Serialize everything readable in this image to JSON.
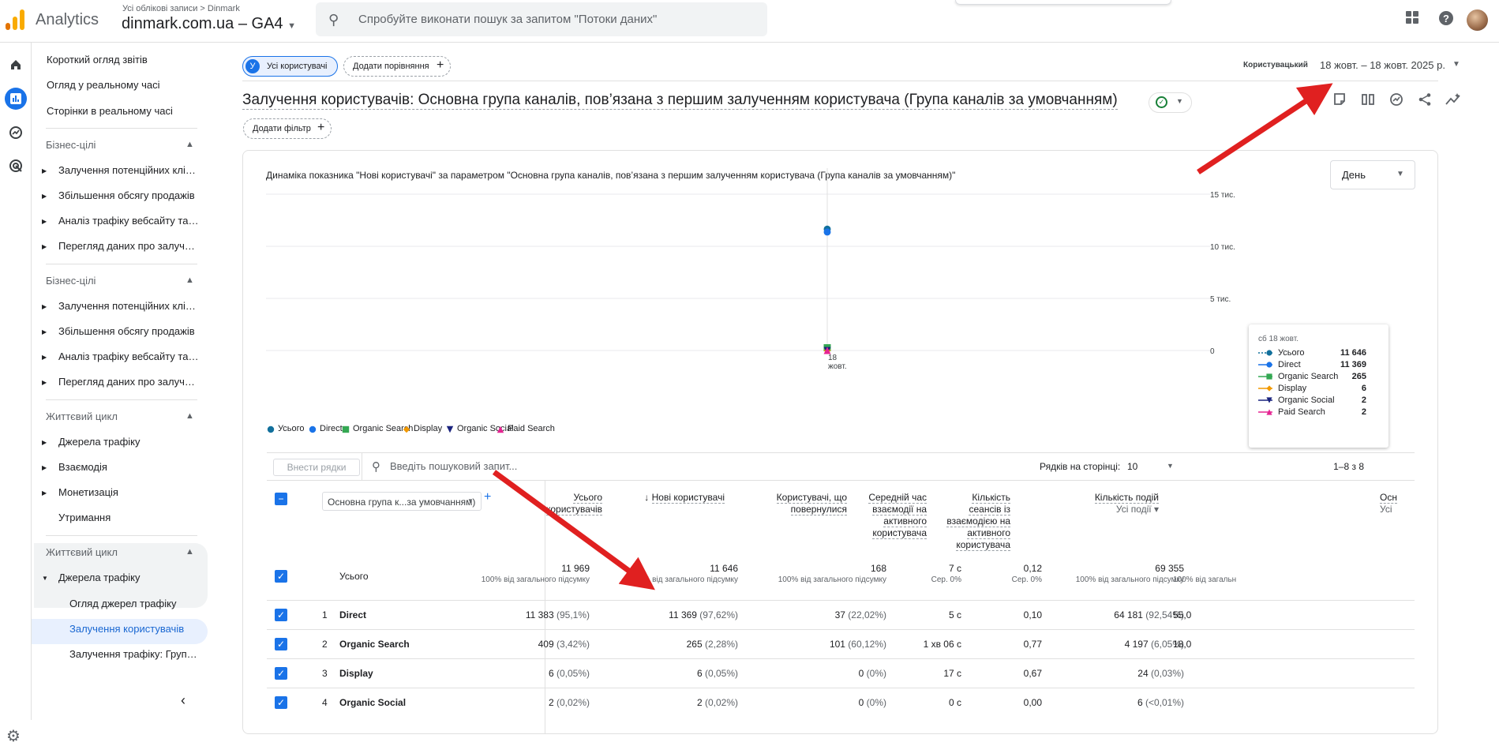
{
  "app": {
    "name": "Analytics",
    "account_crumb": "Усі облікові записи > Dinmark",
    "property": "dinmark.com.ua – GA4"
  },
  "search": {
    "placeholder": "Спробуйте виконати пошук за запитом \"Потоки даних\""
  },
  "sidebar": {
    "top_items": [
      "Короткий огляд звітів",
      "Огляд у реальному часі",
      "Сторінки в реальному часі"
    ],
    "group1": {
      "title": "Бізнес-цілі",
      "items": [
        "Залучення потенційних клієнтів",
        "Збільшення обсягу продажів",
        "Аналіз трафіку вебсайту та/або додатка",
        "Перегляд даних про залучення користувачів"
      ]
    },
    "group2": {
      "title": "Бізнес-цілі",
      "items": [
        "Залучення потенційних клієнтів",
        "Збільшення обсягу продажів",
        "Аналіз трафіку вебсайту та/або додатка",
        "Перегляд даних про залучення користувачів"
      ]
    },
    "group3": {
      "title": "Життєвий цикл",
      "items": [
        "Джерела трафіку",
        "Взаємодія",
        "Монетизація"
      ],
      "extra": "Утримання"
    },
    "group4": {
      "title": "Життєвий цикл",
      "open": "Джерела трафіку",
      "children": [
        "Огляд джерел трафіку",
        "Залучення користувачів",
        "Залучення трафіку: Група каналів"
      ]
    }
  },
  "compare": {
    "segment_letter": "У",
    "segment_label": "Усі користувачі",
    "add_comparison": "Додати порівняння"
  },
  "date": {
    "label": "Користувацький",
    "range": "18 жовт. – 18 жовт. 2025 р."
  },
  "title": "Залучення користувачів: Основна група каналів, пов’язана з першим залученням користувача (Група каналів за умовчанням)",
  "add_filter": "Додати фільтр",
  "chart_data": {
    "type": "line",
    "title": "Динаміка показника \"Нові користувачі\" за параметром \"Основна група каналів, пов’язана з першим залученням користувача (Група каналів за умовчанням)\"",
    "granularity": "День",
    "x": [
      "18 жовт."
    ],
    "x_tick_line1": "18",
    "x_tick_line2": "жовт.",
    "y_ticks": [
      "15 тис.",
      "10 тис.",
      "5 тис.",
      "0"
    ],
    "ylim": [
      0,
      15000
    ],
    "series": [
      {
        "name": "Усього",
        "values": [
          11646
        ],
        "color": "#12709c",
        "marker": "pin"
      },
      {
        "name": "Direct",
        "values": [
          11369
        ],
        "color": "#1a73e8",
        "marker": "circle"
      },
      {
        "name": "Organic Search",
        "values": [
          265
        ],
        "color": "#34a853",
        "marker": "square"
      },
      {
        "name": "Display",
        "values": [
          6
        ],
        "color": "#f29900",
        "marker": "diamond"
      },
      {
        "name": "Organic Social",
        "values": [
          2
        ],
        "color": "#1a237e",
        "marker": "triangle-down"
      },
      {
        "name": "Paid Search",
        "values": [
          2
        ],
        "color": "#e52592",
        "marker": "triangle-up"
      }
    ]
  },
  "tooltip": {
    "date": "сб 18 жовт.",
    "values": [
      "11 646",
      "11 369",
      "265",
      "6",
      "2",
      "2"
    ]
  },
  "table_controls": {
    "add_rows": "Внести рядки",
    "search_placeholder": "Введіть пошуковий запит...",
    "rows_per_page_label": "Рядків на сторінці:",
    "rows_per_page": "10",
    "pager": "1–8 з 8"
  },
  "table": {
    "dimension_select": "Основна група к...за умовчанням)",
    "columns": [
      {
        "label": "Усього користувачів"
      },
      {
        "label": "Нові користувачі",
        "sorted": "↓"
      },
      {
        "label": "Користувачі, що повернулися"
      },
      {
        "label": "Середній час взаємодії на активного користувача"
      },
      {
        "label": "Кількість сеансів із взаємодією на активного користувача"
      },
      {
        "label": "Кількість подій",
        "sub": "Усі події"
      },
      {
        "label": "Осн",
        "sub": "Усі"
      }
    ],
    "total": {
      "label": "Усього",
      "values": [
        "11 969",
        "11 646",
        "168",
        "7 с",
        "0,12",
        "69 355",
        ""
      ],
      "subs": [
        "100% від загального підсумку",
        "100% від загального підсумку",
        "100% від загального підсумку",
        "Сер. 0%",
        "Сер. 0%",
        "100% від загального підсумку",
        "100% від загальн"
      ]
    },
    "rows": [
      {
        "n": "1",
        "name": "Direct",
        "cells": [
          [
            "11 383",
            "(95,1%)"
          ],
          [
            "11 369",
            "(97,62%)"
          ],
          [
            "37",
            "(22,02%)"
          ],
          [
            "5 с",
            ""
          ],
          [
            "0,10",
            ""
          ],
          [
            "64 181",
            "(92,54%)"
          ],
          [
            "55,0",
            ""
          ]
        ]
      },
      {
        "n": "2",
        "name": "Organic Search",
        "cells": [
          [
            "409",
            "(3,42%)"
          ],
          [
            "265",
            "(2,28%)"
          ],
          [
            "101",
            "(60,12%)"
          ],
          [
            "1 хв 06 с",
            ""
          ],
          [
            "0,77",
            ""
          ],
          [
            "4 197",
            "(6,05%)"
          ],
          [
            "18,0",
            ""
          ]
        ]
      },
      {
        "n": "3",
        "name": "Display",
        "cells": [
          [
            "6",
            "(0,05%)"
          ],
          [
            "6",
            "(0,05%)"
          ],
          [
            "0",
            "(0%)"
          ],
          [
            "17 с",
            ""
          ],
          [
            "0,67",
            ""
          ],
          [
            "24",
            "(0,03%)"
          ],
          [
            "",
            ""
          ]
        ]
      },
      {
        "n": "4",
        "name": "Organic Social",
        "cells": [
          [
            "2",
            "(0,02%)"
          ],
          [
            "2",
            "(0,02%)"
          ],
          [
            "0",
            "(0%)"
          ],
          [
            "0 с",
            ""
          ],
          [
            "0,00",
            ""
          ],
          [
            "6",
            "(<0,01%)"
          ],
          [
            "",
            ""
          ]
        ]
      }
    ]
  },
  "colors": {
    "accent": "#1a73e8",
    "annotation_arrow": "#e02020"
  }
}
